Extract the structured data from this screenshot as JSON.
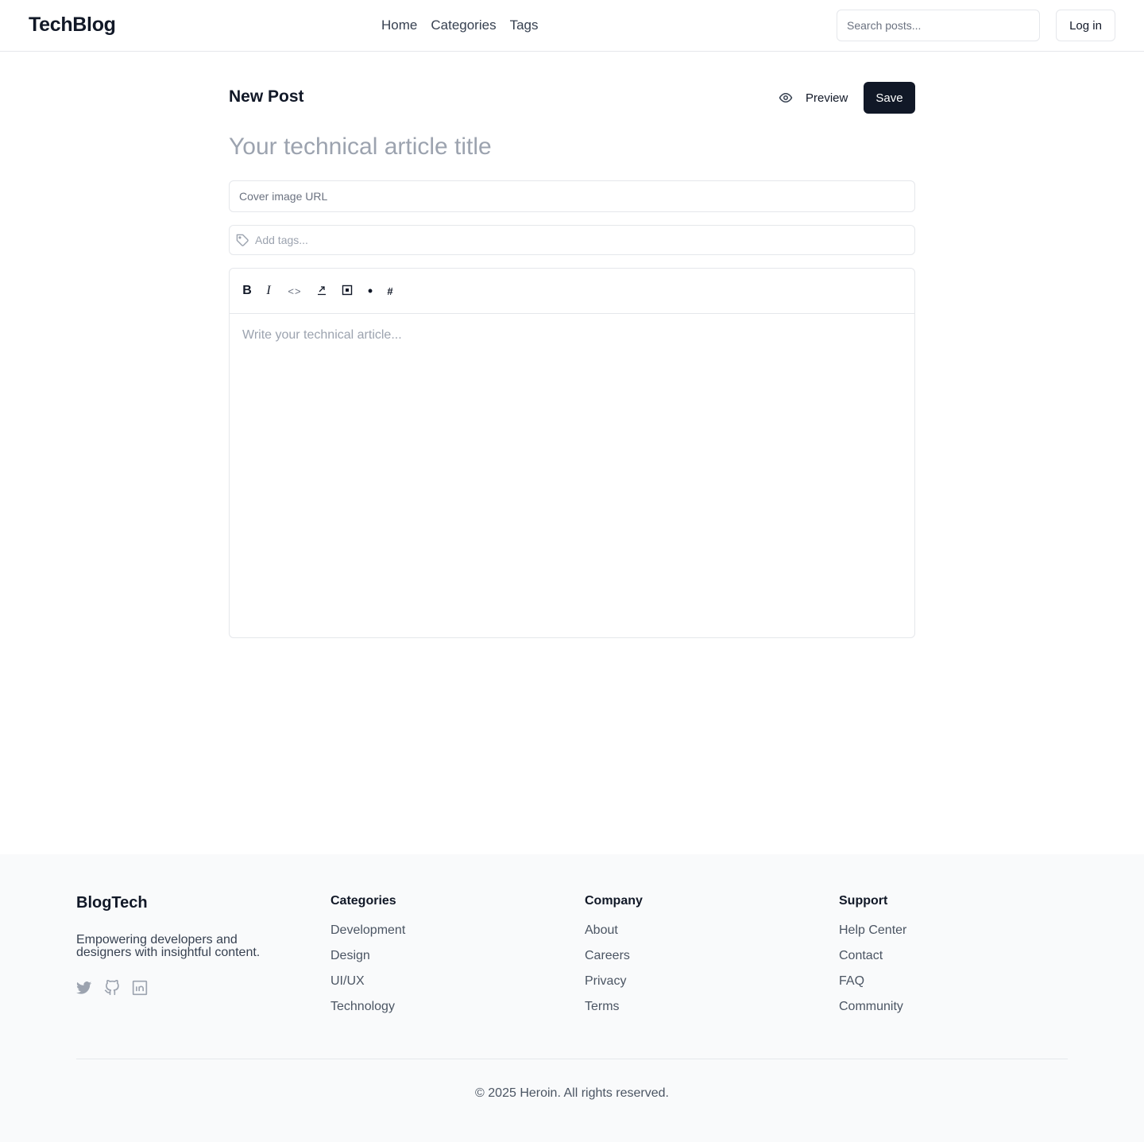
{
  "header": {
    "logo": "TechBlog",
    "nav": [
      "Home",
      "Categories",
      "Tags"
    ],
    "search_placeholder": "Search posts...",
    "login_label": "Log in"
  },
  "editor": {
    "page_title": "New Post",
    "preview_label": "Preview",
    "save_label": "Save",
    "title_placeholder": "Your technical article title",
    "cover_placeholder": "Cover image URL",
    "tags_placeholder": "Add tags...",
    "content_placeholder": "Write your technical article...",
    "toolbar": {
      "bold": "B",
      "italic": "I",
      "code": "<>",
      "list": "•",
      "heading": "#"
    }
  },
  "footer": {
    "brand": "BlogTech",
    "tagline": "Empowering developers and designers with insightful content.",
    "columns": [
      {
        "title": "Categories",
        "links": [
          "Development",
          "Design",
          "UI/UX",
          "Technology"
        ]
      },
      {
        "title": "Company",
        "links": [
          "About",
          "Careers",
          "Privacy",
          "Terms"
        ]
      },
      {
        "title": "Support",
        "links": [
          "Help Center",
          "Contact",
          "FAQ",
          "Community"
        ]
      }
    ],
    "copyright": "© 2025 Heroin. All rights reserved."
  },
  "colors": {
    "primary": "#111827",
    "border": "#e5e7eb",
    "muted": "#9ca3af",
    "footer_bg": "#f9fafb"
  }
}
